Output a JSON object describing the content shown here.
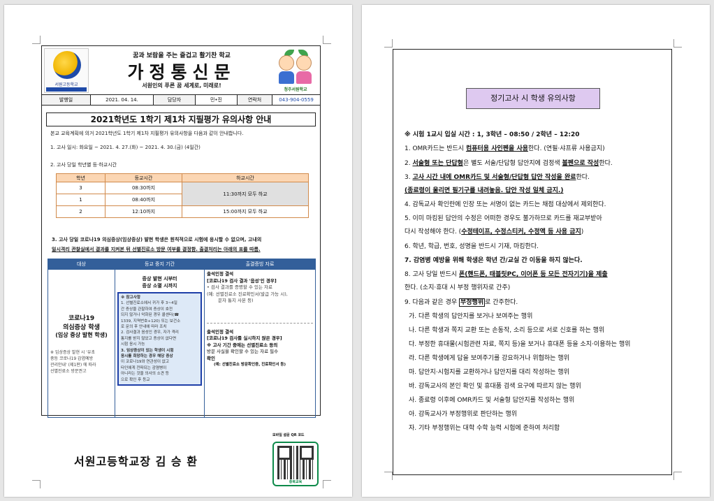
{
  "page1": {
    "masthead": {
      "slogan": "꿈과 보람을 주는 즐겁고 활기찬 학교",
      "title": "가정통신문",
      "motto": "서원인의 푸른 꿈 세계로, 미래로!",
      "left_logo_text": "서원고등학교",
      "right_logo_text": "청주서원학교"
    },
    "info": {
      "issue_label": "발행일",
      "issue_value": "2021. 04. 14.",
      "person_label": "담당자",
      "person_value": "민•진",
      "contact_label": "연락처",
      "contact_value": "043-904-0559"
    },
    "doc_title": "2021학년도 1학기 제1차 지필평가 유의사항 안내",
    "intro": "본교 교육계획에 의거 2021학년도 1학기 제1차 지필평가 유의사항을 다음과 같이 안내합니다.",
    "item1_prefix": "1. 고사 일시: ",
    "item1_value": "화요일 ~ 2021. 4. 27.(화) ~ 2021. 4. 30.(금) (4일간)",
    "item2": "2. 고사 당일 학년별 등·하교시간",
    "schedule": {
      "headers": [
        "학년",
        "등교시간",
        "하교시간"
      ],
      "rows": [
        {
          "grade": "3",
          "arrive": "08:30까지"
        },
        {
          "grade": "1",
          "arrive": "08:40까지"
        },
        {
          "grade": "2",
          "arrive": "12:10까지",
          "leave": "15:00까지 모두 하교"
        }
      ],
      "merged_leave": "11:30까지 모두 하교"
    },
    "item3_line1": "3. 고사 당일 코로나19 의심증상(임상증상) 발현 학생은 원칙적으로 시험에 응시할 수 없으며, 고내의",
    "item3_line2": "일시격리 관찰실에서 결과를 지켜본 뒤 선별진료소 방문 여부를 결정함. 출결처리는 아래의 표를 따름.",
    "covid_table": {
      "headers": [
        "대상",
        "등교 중지 기간",
        "출결증빙 자료"
      ],
      "target_title": "코로나19",
      "target_sub1": "의심증상 학생",
      "target_sub2": "(임상 증상 발현 학생)",
      "target_note": [
        "※ 임상증상 발현 시 '유초",
        "중등 코로나19 감염예방",
        "관리안내' (제1판) 에 따라",
        "선별진료소 방문권고"
      ],
      "period_title1": "증상 발현 시부터",
      "period_title2": "증상 소멸 시까지",
      "ref_title": "※ 참고사항",
      "ref_lines": [
        "1. 선별진료소에서 귀가 후 3~4일",
        "간 증상을 관찰하여 증상이 호전",
        "되지 않거나 악화된 경우 콜센터(☎",
        "1339, 지역번호+120) 또는 보건소",
        "로 문의 후 안내에 따라 조치",
        "2. 검사결과 음성인 경우, 자가 격리",
        "통지를 받지 않았고 증상이 없다면",
        "시험 응시 가능",
        "3. 임상증상이 있는 학생이 시험",
        "응시를 희망하는 경우 해당 증상",
        "이 코로나19와 연관성이 없고",
        "타인에게 전파되는 감염병이",
        "아니라는 것을 의사의 소견 등",
        "으로 확인 후 등교"
      ],
      "ev1_title": "출석인정 결석",
      "ev1_sub": "[코로나19 검사 결과 '음성'인 경우]",
      "ev1_lines": [
        "• 검사 결과를 증명할 수 있는 자료",
        "(예: 선별진료소 진료확인서(발급 가능 시),",
        "문자 통지 사본 등)"
      ],
      "ev2_title": "출석인정 결석",
      "ev2_sub": "[코로나19 검사를 실시하지 않은 경우]",
      "ev2_lines": [
        "※ 고사 기간 중에는 선별진료소 등의",
        "방문 사실을 확인할 수 있는 자료 필수",
        "확인"
      ],
      "ev2_note": "(예: 선별진료소 방문확인증, 진료확인서 등)"
    },
    "signature": "서원고등학교장  김 승 환",
    "qr_caption": "모바일 설문 QR 코드",
    "qr_footer": "충북교육"
  },
  "page2": {
    "heading": "정기고사 시 학생 유의사항",
    "lines": [
      {
        "segs": [
          {
            "t": "※ 시험 1교시 입실 시간 : 1, 3학년 – 08:50 / 2학년 – 12:20",
            "s": "b"
          }
        ]
      },
      {
        "segs": [
          {
            "t": "1. OMR카드는 반드시 "
          },
          {
            "t": "컴퓨터용 사인펜을 사용",
            "s": "u"
          },
          {
            "t": "한다. (연필·샤프류 사용금지)"
          }
        ]
      },
      {
        "segs": [
          {
            "t": "2. "
          },
          {
            "t": "서술형 또는 단답형",
            "s": "u"
          },
          {
            "t": "은 별도 서술/단답형 답안지에 검정색 "
          },
          {
            "t": "볼펜으로 작성",
            "s": "u"
          },
          {
            "t": "한다."
          }
        ]
      },
      {
        "segs": [
          {
            "t": "3. "
          },
          {
            "t": "고사 시간 내에 OMR카드 및 서술형/단답형 답안 작성을 완료",
            "s": "u"
          },
          {
            "t": "한다."
          }
        ]
      },
      {
        "segs": [
          {
            "t": "   "
          },
          {
            "t": "(종료령이 울리면 필기구를 내려놓음. 답안 작성 일체 금지.)",
            "s": "u"
          }
        ]
      },
      {
        "segs": [
          {
            "t": "4. 감독교사 확인란에 인장 또는 서명이 없는 카드는 채점 대상에서 제외한다."
          }
        ]
      },
      {
        "segs": [
          {
            "t": "5. 이미 마킹된 답안의 수정은 어떠한 경우도 불가하므로 카드를 재교부받아"
          }
        ]
      },
      {
        "segs": [
          {
            "t": "   다시 작성해야 한다. ("
          },
          {
            "t": "수정테이프, 수정스티커, 수정액 등 사용 금지",
            "s": "u"
          },
          {
            "t": ")"
          }
        ]
      },
      {
        "segs": [
          {
            "t": "6. 학년, 학급, 번호, 성명을 반드시 기재, 마킹한다."
          }
        ]
      },
      {
        "segs": [
          {
            "t": "7. 감염병 예방을 위해 학생은 학년 간/교실 간 이동을 하지 않는다.",
            "s": "b"
          }
        ]
      },
      {
        "segs": [
          {
            "t": "8. 고사 당일 반드시 "
          },
          {
            "t": "폰(핸드폰, 태블릿PC, 이어폰 등 모든 전자기기)을 제출",
            "s": "u"
          }
        ]
      },
      {
        "segs": [
          {
            "t": "   한다. (소지·휴대 시 부정 행위자로 간주)"
          }
        ]
      },
      {
        "segs": [
          {
            "t": "9. 다음과 같은 경우 "
          },
          {
            "t": "부정행위",
            "s": "box"
          },
          {
            "t": "로 간주한다."
          }
        ]
      },
      {
        "segs": [
          {
            "t": "가. 다른 학생의 답안지를 보거나 보여주는 행위"
          }
        ]
      },
      {
        "segs": [
          {
            "t": "나. 다른 학생과 쪽지 교환 또는 손동작, 소리 등으로 서로 신호를 하는 행위"
          }
        ]
      },
      {
        "segs": [
          {
            "t": "다. 부정한 휴대물(시험관련 자료, 쪽지 등)을 보거나 휴대폰 등을 소지·이용하는 행위"
          }
        ]
      },
      {
        "segs": [
          {
            "t": "라. 다른 학생에게 답을 보여주기를 강요하거나 위협하는 행위"
          }
        ]
      },
      {
        "segs": [
          {
            "t": "마. 답안지·시험지를 교환하거나 답안지를 대리 작성하는 행위"
          }
        ]
      },
      {
        "segs": [
          {
            "t": "바. 감독교사의 본인 확인 및 휴대품 검색 요구에 따르지 않는 행위"
          }
        ]
      },
      {
        "segs": [
          {
            "t": "사. 종료령 이후에 OMR카드 및 서술형 답안지를 작성하는 행위"
          }
        ]
      },
      {
        "segs": [
          {
            "t": "아. 감독교사가 부정행위로 판단하는 행위"
          }
        ]
      },
      {
        "segs": [
          {
            "t": "자. 기타 부정행위는 대학 수학 능력 시험에 준하여 처리함"
          }
        ]
      }
    ]
  }
}
